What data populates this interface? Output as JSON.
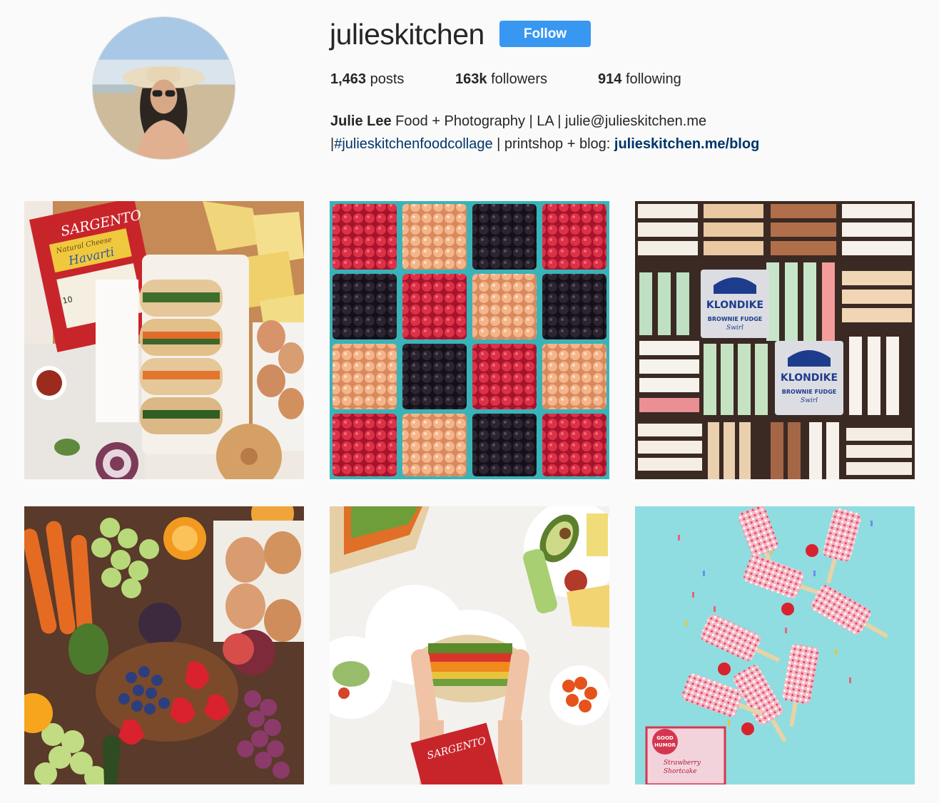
{
  "profile": {
    "username": "julieskitchen",
    "follow_label": "Follow",
    "stats": {
      "posts_count": "1,463",
      "posts_label": "posts",
      "followers_count": "163k",
      "followers_label": "followers",
      "following_count": "914",
      "following_label": "following"
    },
    "bio": {
      "name": "Julie Lee",
      "line1": "Food + Photography | LA | julie@julieskitchen.me",
      "line2_prefix": "|",
      "hashtag": "#julieskitchenfoodcollage",
      "line2_middle": "| printshop + blog:",
      "link": "julieskitchen.me/blog"
    }
  },
  "posts": [
    {
      "id": "post-1",
      "subject": "sandwiches-cheese-eggs",
      "labels": {
        "brand": "SARGENTO",
        "sub": "Natural Cheese",
        "product": "Havarti",
        "count": "10"
      }
    },
    {
      "id": "post-2",
      "subject": "berry-baskets"
    },
    {
      "id": "post-3",
      "subject": "ice-cream-sandwiches",
      "labels": {
        "brand": "KLONDIKE",
        "product_line1": "BROWNIE FUDGE",
        "product_line2": "Swirl"
      }
    },
    {
      "id": "post-4",
      "subject": "fruit-vegetable-spread"
    },
    {
      "id": "post-5",
      "subject": "sandwich-in-hands",
      "labels": {
        "brand": "SARGENTO"
      }
    },
    {
      "id": "post-6",
      "subject": "popsicles-on-blue",
      "labels": {
        "brand_line1": "GOOD",
        "brand_line2": "HUMOR",
        "product_line1": "Strawberry",
        "product_line2": "Shortcake"
      }
    }
  ],
  "colors": {
    "follow_button": "#3897f0",
    "link": "#003569",
    "background": "#fafafa",
    "text": "#262626"
  }
}
